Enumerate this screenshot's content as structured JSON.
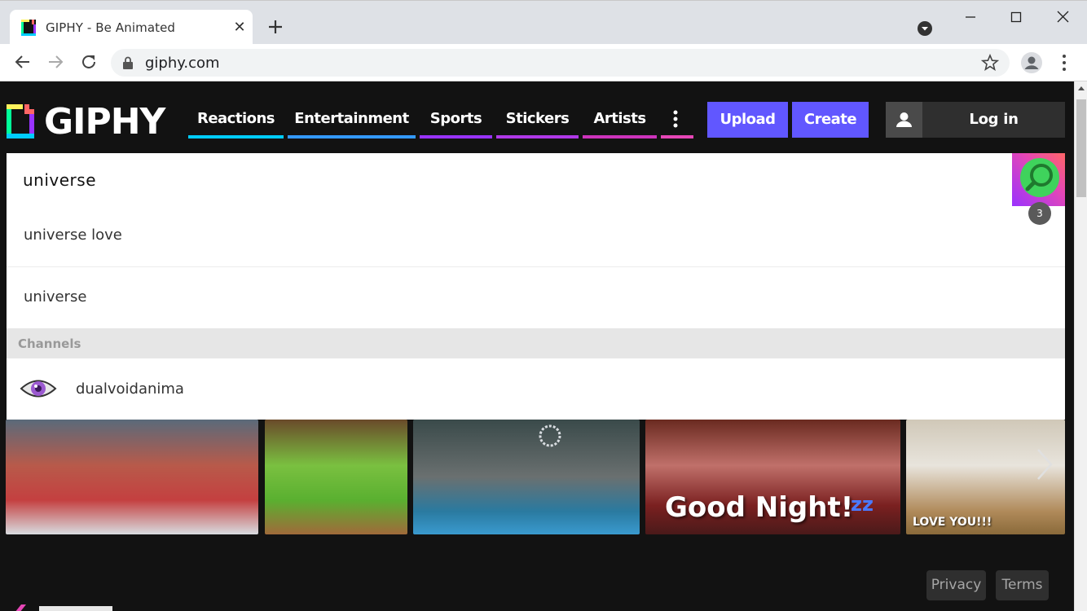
{
  "browser": {
    "tab_title": "GIPHY - Be Animated",
    "url": "giphy.com"
  },
  "colors": {
    "brand_purple": "#6157ff",
    "reactions": "#00ccff",
    "entertainment": "#3399ff",
    "sports": "#9933ff",
    "stickers": "#b039e8",
    "artists": "#cc33bb",
    "more": "#e646b6"
  },
  "header": {
    "logo_text": "GIPHY",
    "nav": {
      "reactions": "Reactions",
      "entertainment": "Entertainment",
      "sports": "Sports",
      "stickers": "Stickers",
      "artists": "Artists"
    },
    "upload_label": "Upload",
    "create_label": "Create",
    "login_label": "Log in"
  },
  "search": {
    "value": "universe",
    "badge_count": "3",
    "suggestions": [
      "universe love",
      "universe"
    ],
    "channels_header": "Channels",
    "channel_name": "dualvoidanima"
  },
  "gifs": {
    "good_night_caption": "Good Night!",
    "good_night_zz": "zz",
    "love_you_caption": "LOVE YOU!!!"
  },
  "footer": {
    "privacy_label": "Privacy",
    "terms_label": "Terms"
  }
}
